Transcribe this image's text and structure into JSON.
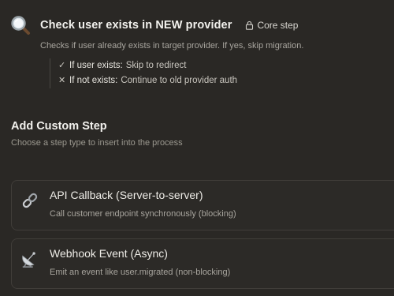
{
  "step": {
    "icon": "magnifier-icon",
    "title": "Check user exists in NEW provider",
    "badge": "Core step",
    "badge_icon": "lock-icon",
    "description": "Checks if user already exists in target provider. If yes, skip migration.",
    "branches": [
      {
        "mark": "✓",
        "condition": "If user exists:",
        "action": "Skip to redirect"
      },
      {
        "mark": "✕",
        "condition": "If not exists:",
        "action": "Continue to old provider auth"
      }
    ]
  },
  "custom": {
    "title": "Add Custom Step",
    "subtitle": "Choose a step type to insert into the process",
    "options": [
      {
        "icon": "link-icon",
        "title": "API Callback (Server-to-server)",
        "description": "Call customer endpoint synchronously (blocking)"
      },
      {
        "icon": "satellite-dish-icon",
        "title": "Webhook Event (Async)",
        "description": "Emit an event like user.migrated (non-blocking)"
      }
    ]
  }
}
